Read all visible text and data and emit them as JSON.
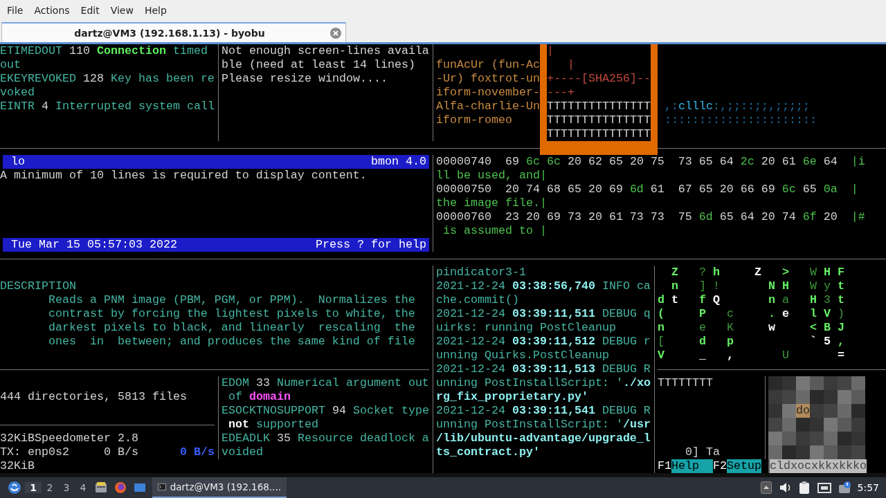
{
  "menu": [
    "File",
    "Actions",
    "Edit",
    "View",
    "Help"
  ],
  "tabs": [
    {
      "title": "dartz@VM3 (192.168.1.13) - byobu",
      "selected": true
    }
  ],
  "terminal": {
    "blocks": [
      {
        "kind": "text",
        "lines": [
          [
            {
              "text": "ETIMEDOUT",
              "color": "#45b5a2",
              "bold": false
            },
            {
              "text": " 110 ",
              "color": "#d3d3d3",
              "bold": false
            },
            {
              "text": "Connection",
              "color": "#5ef05e",
              "bold": true
            },
            {
              "text": " timed",
              "color": "#45b5a2",
              "bold": false
            }
          ],
          [
            {
              "text": "out",
              "color": "#45b5a2",
              "bold": false
            }
          ],
          [
            {
              "text": "EKEYREVOKED",
              "color": "#45b5a2",
              "bold": false
            },
            {
              "text": " 128 ",
              "color": "#d3d3d3",
              "bold": false
            },
            {
              "text": "Key has been re",
              "color": "#45b5a2",
              "bold": false
            }
          ],
          [
            {
              "text": "voked",
              "color": "#45b5a2",
              "bold": false
            }
          ],
          [
            {
              "text": "EINTR",
              "color": "#45b5a2",
              "bold": false
            },
            {
              "text": " 4 ",
              "color": "#d3d3d3",
              "bold": false
            },
            {
              "text": "Interrupted system call",
              "color": "#45b5a2",
              "bold": false
            }
          ]
        ]
      },
      {
        "kind": "text",
        "lines": [
          [
            {
              "text": "Not enough screen-lines availa",
              "color": "#d3d3d3",
              "bold": false
            }
          ],
          [
            {
              "text": "ble (need at least 14 lines)",
              "color": "#d3d3d3",
              "bold": false
            }
          ],
          [
            {
              "text": "Please resize window....",
              "color": "#d3d3d3",
              "bold": false
            }
          ]
        ]
      },
      {
        "kind": "text",
        "lines": [
          [
            {
              "text": "funAcUr (fun-Ac",
              "color": "#c98a40",
              "bold": false
            }
          ],
          [
            {
              "text": "-Ur) foxtrot-un",
              "color": "#c98a40",
              "bold": false
            }
          ],
          [
            {
              "text": "iform-november-",
              "color": "#c98a40",
              "bold": false
            }
          ],
          [
            {
              "text": "Alfa-charlie-Un",
              "color": "#c98a40",
              "bold": false
            }
          ],
          [
            {
              "text": "iform-romeo",
              "color": "#c98a40",
              "bold": false
            }
          ]
        ]
      },
      {
        "kind": "box",
        "lines": [
          {
            "kind": "frame",
            "text": "|"
          },
          {
            "kind": "frame",
            "text": "   |"
          },
          {
            "kind": "frame",
            "text": "+----[SHA256]--"
          },
          {
            "kind": "frame",
            "text": "---+"
          },
          {
            "kind": "fill",
            "text": "TTTTTTTTTTTTTTT"
          },
          {
            "kind": "fill",
            "text": "TTTTTTTTTTTTTTT"
          },
          {
            "kind": "fill",
            "text": "TTTTTTTTTTTTTTT"
          }
        ]
      },
      {
        "kind": "text",
        "lines": [
          [
            {
              "text": " ,:",
              "color": "#1c6fa0",
              "bold": false
            },
            {
              "text": "clllc",
              "color": "#2fb6ea",
              "bold": false
            },
            {
              "text": ":,;;::;;,;;;;;",
              "color": "#1c6fa0",
              "bold": false
            }
          ],
          [
            {
              "text": " ::::::::::::::::::::::",
              "color": "#1c6fa0",
              "bold": false
            }
          ]
        ]
      },
      {
        "kind": "bmon",
        "top_bar": {
          "left": "lo",
          "right": "bmon 4.0"
        },
        "message": "A minimum of 10 lines is required to display content.",
        "bottom_bar": {
          "left": "Tue Mar 15 05:57:03 2022",
          "right": "Press ? for help"
        }
      },
      {
        "kind": "text",
        "lines": [
          [
            {
              "text": "00000740  69 ",
              "color": "#d3d3d3",
              "bold": false
            },
            {
              "text": "6c 6c",
              "color": "#4cc04c",
              "bold": false
            },
            {
              "text": " 20 62 65 20 75  73 65 64 ",
              "color": "#d3d3d3",
              "bold": false
            },
            {
              "text": "2c",
              "color": "#4cc04c",
              "bold": false
            },
            {
              "text": " 20 61 ",
              "color": "#d3d3d3",
              "bold": false
            },
            {
              "text": "6e",
              "color": "#4cc04c",
              "bold": false
            },
            {
              "text": " 64  ",
              "color": "#d3d3d3",
              "bold": false
            },
            {
              "text": "|i",
              "color": "#4cc04c",
              "bold": false
            }
          ],
          [
            {
              "text": "ll be used, and|",
              "color": "#4cc04c",
              "bold": false
            }
          ],
          [
            {
              "text": "00000750  20 74 68 65 20 69 ",
              "color": "#d3d3d3",
              "bold": false
            },
            {
              "text": "6d",
              "color": "#4cc04c",
              "bold": false
            },
            {
              "text": " 61  67 65 20 66 69 ",
              "color": "#d3d3d3",
              "bold": false
            },
            {
              "text": "6c",
              "color": "#4cc04c",
              "bold": false
            },
            {
              "text": " 65 ",
              "color": "#d3d3d3",
              "bold": false
            },
            {
              "text": "0a",
              "color": "#4cc04c",
              "bold": false
            },
            {
              "text": "  |",
              "color": "#4cc04c",
              "bold": false
            }
          ],
          [
            {
              "text": "the image file.|",
              "color": "#4cc04c",
              "bold": false
            }
          ],
          [
            {
              "text": "00000760  23 20 69 73 20 61 73 73  75 ",
              "color": "#d3d3d3",
              "bold": false
            },
            {
              "text": "6d",
              "color": "#4cc04c",
              "bold": false
            },
            {
              "text": " 65 64 20 74 ",
              "color": "#d3d3d3",
              "bold": false
            },
            {
              "text": "6f",
              "color": "#4cc04c",
              "bold": false
            },
            {
              "text": " 20  ",
              "color": "#d3d3d3",
              "bold": false
            },
            {
              "text": "|#",
              "color": "#4cc04c",
              "bold": false
            }
          ],
          [
            {
              "text": " is assumed to |",
              "color": "#4cc04c",
              "bold": false
            }
          ]
        ]
      },
      {
        "kind": "text",
        "lines": [
          [
            {
              "text": "DESCRIPTION",
              "color": "#45b5a2",
              "bold": false
            }
          ],
          [
            {
              "text": "       Reads a PNM image (PBM, PGM, or PPM).  Normalizes the",
              "color": "#45b5a2",
              "bold": false
            }
          ],
          [
            {
              "text": "       contrast by forcing the lightest pixels to white, the",
              "color": "#45b5a2",
              "bold": false
            }
          ],
          [
            {
              "text": "       darkest pixels to black, and linearly  rescaling  the",
              "color": "#45b5a2",
              "bold": false
            }
          ],
          [
            {
              "text": "       ones  in  between; and produces the same kind of file",
              "color": "#45b5a2",
              "bold": false
            }
          ]
        ]
      },
      {
        "kind": "text",
        "lines": [
          [
            {
              "text": "pindicator3-1",
              "color": "#45b5a2",
              "bold": false
            }
          ],
          [
            {
              "text": "2021-12-24 ",
              "color": "#45b5a2",
              "bold": false
            },
            {
              "text": "03:38:56,740",
              "color": "#8ff0f0",
              "bold": true
            },
            {
              "text": " INFO ca",
              "color": "#45b5a2",
              "bold": false
            }
          ],
          [
            {
              "text": "che.commit()",
              "color": "#45b5a2",
              "bold": false
            }
          ],
          [
            {
              "text": "2021-12-24 ",
              "color": "#45b5a2",
              "bold": false
            },
            {
              "text": "03:39:11,511",
              "color": "#8ff0f0",
              "bold": true
            },
            {
              "text": " DEBUG q",
              "color": "#45b5a2",
              "bold": false
            }
          ],
          [
            {
              "text": "uirks: running PostCleanup",
              "color": "#45b5a2",
              "bold": false
            }
          ],
          [
            {
              "text": "2021-12-24 ",
              "color": "#45b5a2",
              "bold": false
            },
            {
              "text": "03:39:11,512",
              "color": "#8ff0f0",
              "bold": true
            },
            {
              "text": " DEBUG r",
              "color": "#45b5a2",
              "bold": false
            }
          ],
          [
            {
              "text": "unning Quirks.PostCleanup",
              "color": "#45b5a2",
              "bold": false
            }
          ],
          [
            {
              "text": "2021-12-24 ",
              "color": "#45b5a2",
              "bold": false
            },
            {
              "text": "03:39:11,513",
              "color": "#8ff0f0",
              "bold": true
            },
            {
              "text": " DEBUG R",
              "color": "#45b5a2",
              "bold": false
            }
          ],
          [
            {
              "text": "unning PostInstallScript: '",
              "color": "#45b5a2",
              "bold": false
            },
            {
              "text": "./xo",
              "color": "#8ff0f0",
              "bold": true
            }
          ],
          [
            {
              "text": "rg_fix_proprietary.py'",
              "color": "#8ff0f0",
              "bold": true
            }
          ],
          [
            {
              "text": "2021-12-24 ",
              "color": "#45b5a2",
              "bold": false
            },
            {
              "text": "03:39:11,541",
              "color": "#8ff0f0",
              "bold": true
            },
            {
              "text": " DEBUG R",
              "color": "#45b5a2",
              "bold": false
            }
          ],
          [
            {
              "text": "unning PostInstallScript: '",
              "color": "#45b5a2",
              "bold": false
            },
            {
              "text": "/usr",
              "color": "#8ff0f0",
              "bold": true
            }
          ],
          [
            {
              "text": "/lib/ubuntu-advantage/upgrade_l",
              "color": "#8ff0f0",
              "bold": true
            }
          ],
          [
            {
              "text": "ts_contract.py'",
              "color": "#8ff0f0",
              "bold": true
            }
          ]
        ]
      },
      {
        "kind": "matrix",
        "lines": [
          [
            {
              "text": "  Z",
              "color": "#66f066",
              "bold": true
            },
            {
              "text": "   ?",
              "color": "#3c9a3c",
              "bold": false
            },
            {
              "text": " h",
              "color": "#66f066",
              "bold": true
            },
            {
              "text": "     Z",
              "color": "#ffffff",
              "bold": true
            },
            {
              "text": "   >",
              "color": "#66f066",
              "bold": true
            },
            {
              "text": "   W",
              "color": "#3c9a3c",
              "bold": false
            },
            {
              "text": " H",
              "color": "#66f066",
              "bold": true
            },
            {
              "text": " F",
              "color": "#66f066",
              "bold": true
            }
          ],
          [
            {
              "text": "  n",
              "color": "#66f066",
              "bold": true
            },
            {
              "text": "   ] !",
              "color": "#3c9a3c",
              "bold": false
            },
            {
              "text": "       N",
              "color": "#66f066",
              "bold": true
            },
            {
              "text": " H",
              "color": "#66f066",
              "bold": true
            },
            {
              "text": "   W",
              "color": "#3c9a3c",
              "bold": false
            },
            {
              "text": " y",
              "color": "#3c9a3c",
              "bold": false
            },
            {
              "text": " t",
              "color": "#66f066",
              "bold": true
            }
          ],
          [
            {
              "text": "d",
              "color": "#66f066",
              "bold": true
            },
            {
              "text": " t",
              "color": "#ffffff",
              "bold": true
            },
            {
              "text": "   f",
              "color": "#66f066",
              "bold": true
            },
            {
              "text": " Q",
              "color": "#ffffff",
              "bold": true
            },
            {
              "text": "       n",
              "color": "#66f066",
              "bold": true
            },
            {
              "text": " a",
              "color": "#3c9a3c",
              "bold": false
            },
            {
              "text": "   H",
              "color": "#66f066",
              "bold": true
            },
            {
              "text": " 3",
              "color": "#3c9a3c",
              "bold": false
            },
            {
              "text": " t",
              "color": "#66f066",
              "bold": true
            }
          ],
          [
            {
              "text": "(",
              "color": "#66f066",
              "bold": true
            },
            {
              "text": "     P",
              "color": "#66f066",
              "bold": true
            },
            {
              "text": "   c",
              "color": "#3c9a3c",
              "bold": false
            },
            {
              "text": "     .",
              "color": "#66f066",
              "bold": true
            },
            {
              "text": " e",
              "color": "#ffffff",
              "bold": true
            },
            {
              "text": "   l",
              "color": "#66f066",
              "bold": true
            },
            {
              "text": " V",
              "color": "#66f066",
              "bold": true
            },
            {
              "text": " )",
              "color": "#3c9a3c",
              "bold": false
            }
          ],
          [
            {
              "text": "n",
              "color": "#66f066",
              "bold": true
            },
            {
              "text": "     e",
              "color": "#3c9a3c",
              "bold": false
            },
            {
              "text": "   K",
              "color": "#3c9a3c",
              "bold": false
            },
            {
              "text": "     w",
              "color": "#ffffff",
              "bold": true
            },
            {
              "text": "     <",
              "color": "#66f066",
              "bold": true
            },
            {
              "text": " B",
              "color": "#66f066",
              "bold": true
            },
            {
              "text": " J",
              "color": "#66f066",
              "bold": true
            }
          ],
          [
            {
              "text": "[",
              "color": "#3c9a3c",
              "bold": false
            },
            {
              "text": "     d",
              "color": "#66f066",
              "bold": true
            },
            {
              "text": "   p",
              "color": "#66f066",
              "bold": true
            },
            {
              "text": "           ` 5",
              "color": "#ffffff",
              "bold": true
            },
            {
              "text": " ,",
              "color": "#66f066",
              "bold": true
            }
          ],
          [
            {
              "text": "V",
              "color": "#66f066",
              "bold": true
            },
            {
              "text": "     _   ,",
              "color": "#ffffff",
              "bold": true
            },
            {
              "text": "       U",
              "color": "#3c9a3c",
              "bold": false
            },
            {
              "text": "       =",
              "color": "#ffffff",
              "bold": true
            }
          ]
        ]
      },
      {
        "kind": "text",
        "lines": [
          [
            {
              "text": "444 directories, 5813 files",
              "color": "#d3d3d3",
              "bold": false
            }
          ]
        ]
      },
      {
        "kind": "text",
        "lines": [
          [
            {
              "text": "32KiBSpeedometer 2.8",
              "color": "#d3d3d3",
              "bold": false
            }
          ],
          [
            {
              "text": "TX: enp0s2     0 B/s",
              "color": "#d3d3d3",
              "bold": false
            },
            {
              "text": "      0 B/s",
              "color": "#3a5cff",
              "bold": true
            }
          ],
          [
            {
              "text": "32KiB",
              "color": "#d3d3d3",
              "bold": false
            }
          ]
        ]
      },
      {
        "kind": "text",
        "lines": [
          [
            {
              "text": "EDOM",
              "color": "#45b5a2",
              "bold": false
            },
            {
              "text": " 33 ",
              "color": "#d3d3d3",
              "bold": false
            },
            {
              "text": "Numerical argument out",
              "color": "#45b5a2",
              "bold": false
            }
          ],
          [
            {
              "text": " of ",
              "color": "#45b5a2",
              "bold": false
            },
            {
              "text": "domain",
              "color": "#ff55ff",
              "bold": true
            }
          ],
          [
            {
              "text": "ESOCKTNOSUPPORT",
              "color": "#45b5a2",
              "bold": false
            },
            {
              "text": " 94 ",
              "color": "#d3d3d3",
              "bold": false
            },
            {
              "text": "Socket type",
              "color": "#45b5a2",
              "bold": false
            }
          ],
          [
            {
              "text": " not",
              "color": "#ffffff",
              "bold": true
            },
            {
              "text": " supported",
              "color": "#45b5a2",
              "bold": false
            }
          ],
          [
            {
              "text": "EDEADLK",
              "color": "#45b5a2",
              "bold": false
            },
            {
              "text": " 35 ",
              "color": "#d3d3d3",
              "bold": false
            },
            {
              "text": "Resource deadlock a",
              "color": "#45b5a2",
              "bold": false
            }
          ],
          [
            {
              "text": "voided",
              "color": "#45b5a2",
              "bold": false
            }
          ]
        ]
      },
      {
        "kind": "text",
        "lines": [
          [
            {
              "text": "TTTTTTTT",
              "color": "#d3d3d3",
              "bold": false
            }
          ]
        ]
      },
      {
        "kind": "text",
        "lines": [
          [
            {
              "text": "    0] Ta",
              "color": "#d3d3d3",
              "bold": false
            }
          ]
        ]
      },
      {
        "kind": "fkeys",
        "keys": [
          {
            "key": "F1",
            "label": "Help"
          },
          {
            "key": "F2",
            "label": "Setup"
          }
        ]
      },
      {
        "kind": "art",
        "label": "do",
        "caption": "cldxocxkkxkkko"
      }
    ]
  },
  "taskbar": {
    "workspaces": [
      {
        "label": "1",
        "selected": true
      },
      {
        "label": "2",
        "selected": false
      },
      {
        "label": "3",
        "selected": false
      },
      {
        "label": "4",
        "selected": false
      }
    ],
    "tasks": [
      {
        "title": "dartz@VM3 (192.168....",
        "selected": true
      }
    ],
    "clock": "5:57"
  }
}
